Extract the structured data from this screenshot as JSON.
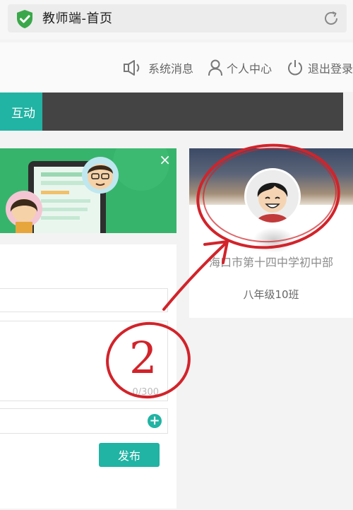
{
  "browser": {
    "title": "教师端-首页",
    "shield_icon": "shield-check-icon",
    "refresh_icon": "refresh-icon"
  },
  "header": {
    "messages_label": "系统消息",
    "profile_label": "个人中心",
    "logout_label": "退出登录"
  },
  "navbar": {
    "active_tab_label": "互动"
  },
  "banner": {
    "close_label": "×"
  },
  "form": {
    "counter": "0/300",
    "attach_plus": "+",
    "publish_label": "发布"
  },
  "profile": {
    "school": "海口市第十四中学初中部",
    "class_name": "八年级10班"
  },
  "annotation": {
    "number": "2"
  },
  "colors": {
    "accent": "#21b3a3",
    "navbar": "#444444",
    "banner": "#37b46b",
    "annotation": "#d2232a"
  }
}
